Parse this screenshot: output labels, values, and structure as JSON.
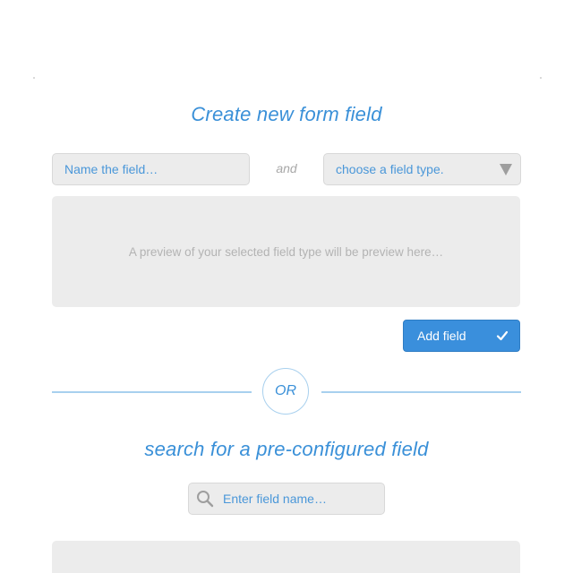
{
  "create": {
    "title": "Create new form field",
    "name_placeholder": "Name the field…",
    "connector": "and",
    "type_select_value": "choose a field type.",
    "preview_text": "A preview of your selected field type will be preview here…",
    "add_button_label": "Add field"
  },
  "divider": {
    "label": "OR"
  },
  "search": {
    "title": "search for a pre-configured field",
    "placeholder": "Enter field name…"
  },
  "icons": {
    "select_caret": "triangle-down-icon",
    "add_check": "check-icon",
    "search": "search-icon"
  },
  "colors": {
    "accent": "#3a8fdc",
    "heading": "#3a90d8",
    "field_bg": "#ececec",
    "divider": "#a8d0ee",
    "muted_text": "#b3b3b3"
  }
}
